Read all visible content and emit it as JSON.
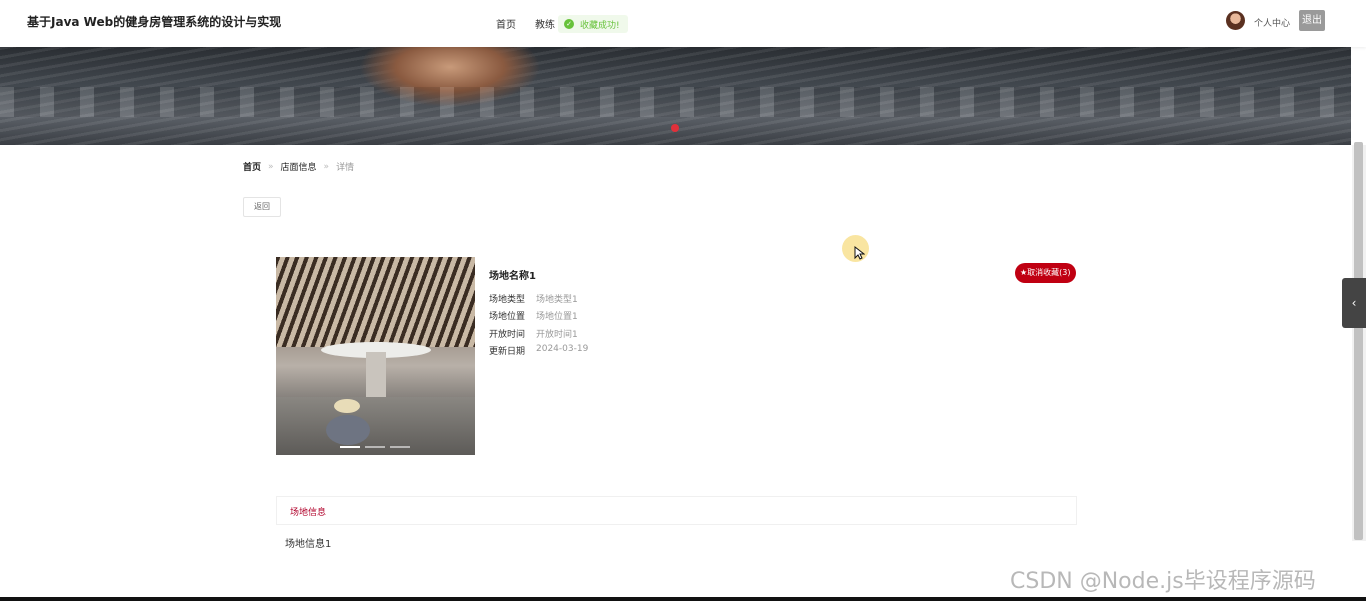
{
  "header": {
    "site_title": "基于Java Web的健身房管理系统的设计与实现",
    "nav": [
      "首页",
      "教练"
    ],
    "toast": "收藏成功!",
    "user_center": "个人中心",
    "logout": "退出"
  },
  "breadcrumb": {
    "home": "首页",
    "sep": "»",
    "section": "店面信息",
    "current": "详情"
  },
  "back_label": "返回",
  "detail": {
    "name": "场地名称1",
    "favorite": "★取消收藏(3)",
    "attrs": [
      {
        "label": "场地类型",
        "value": "场地类型1"
      },
      {
        "label": "场地位置",
        "value": "场地位置1"
      },
      {
        "label": "开放时间",
        "value": "开放时间1"
      },
      {
        "label": "更新日期",
        "value": "2024-03-19"
      }
    ]
  },
  "info": {
    "tab": "场地信息",
    "content": "场地信息1"
  },
  "side_toggle": "‹",
  "watermark": "CSDN @Node.js毕设程序源码",
  "colors": {
    "accent": "#c00012",
    "toast": "#67c23a",
    "logout_bg": "#9a9a9a"
  },
  "icons": {
    "toast": "success-check-icon",
    "cursor": "mouse-pointer-icon",
    "side": "chevron-left-icon"
  }
}
